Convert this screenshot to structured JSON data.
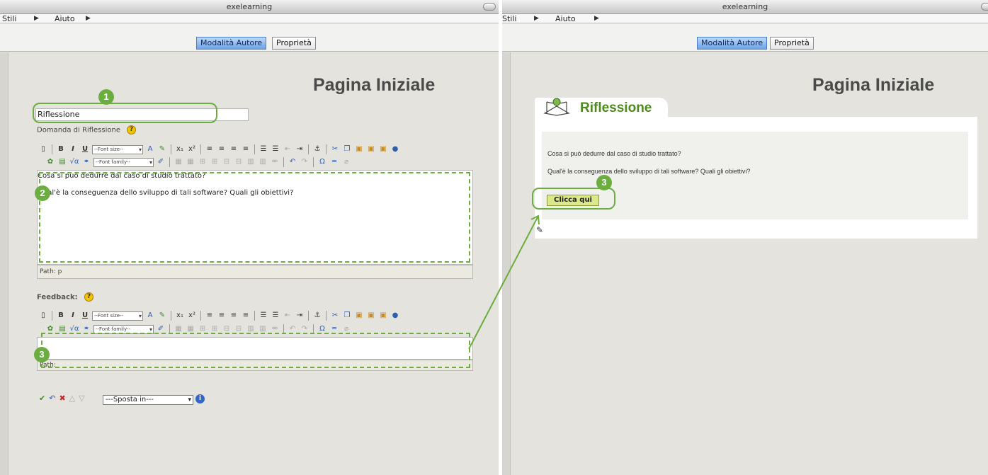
{
  "app_title": "exelearning",
  "menu": [
    "Stili",
    "Aiuto"
  ],
  "tabs": {
    "author": "Modalità Autore",
    "properties": "Proprietà"
  },
  "page_title": "Pagina Iniziale",
  "editor": {
    "title_value": "Riflessione",
    "question_label": "Domanda di Riflessione",
    "font_size_select": "--Font size--",
    "font_family_select": "--Font family--",
    "question_line1": "Cosa  si può  dedurre dal caso di studio trattato?",
    "question_line2": "Qual'è la conseguenza dello sviluppo di tali software? Quali gli obiettivi?",
    "path_label": "Path: p",
    "feedback_label": "Feedback:",
    "feedback_path": "Path:",
    "move_select": "---Sposta in---"
  },
  "preview": {
    "idevice_title": "Riflessione",
    "line1": "Cosa  si può  dedurre dal caso di studio trattato?",
    "line2": "Qual'è la conseguenza dello sviluppo di tali software? Quali gli obiettivi?",
    "button_label": "Clicca qui"
  },
  "badges": [
    "1",
    "2",
    "3",
    "3"
  ],
  "colors": {
    "highlight": "#6cad3f",
    "idevice_title": "#4e8a1f",
    "tab_active": "#6ea2e6",
    "button": "#dce889"
  },
  "icons": [
    "minimize-icon",
    "help-icon",
    "bold-icon",
    "italic-icon",
    "underline-icon",
    "text-color-icon",
    "undo-icon",
    "redo-icon",
    "omega-icon",
    "info-icon",
    "pencil-icon",
    "book-icon",
    "arrow-icon"
  ]
}
